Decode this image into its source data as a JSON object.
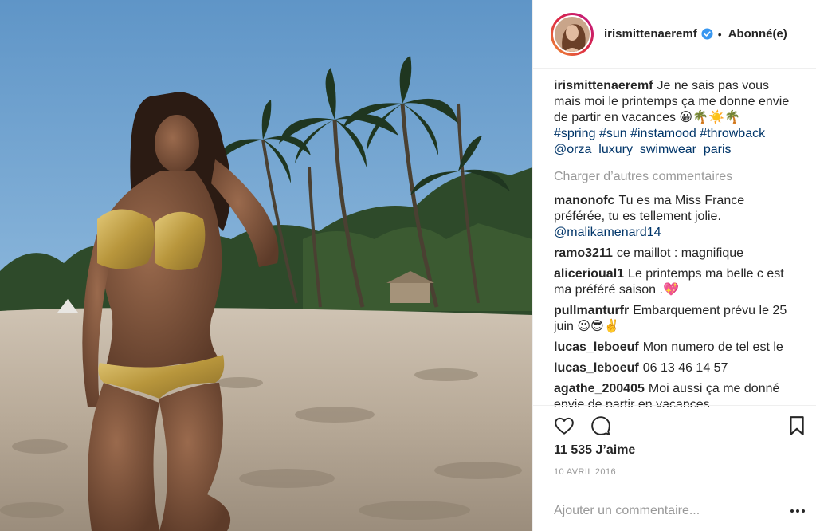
{
  "header": {
    "username": "irismittenaeremf",
    "separator": "•",
    "follow_label": "Abonné(e)"
  },
  "caption": {
    "username": "irismittenaeremf",
    "text": "Je ne sais pas vous mais moi le printemps ça me donne envie de partir en vacances 😀🌴☀️🌴",
    "hashtags": [
      "#spring",
      "#sun",
      "#instamood",
      "#throwback"
    ],
    "mention": "@orza_luxury_swimwear_paris"
  },
  "load_more_label": "Charger d’autres commentaires",
  "comments": [
    {
      "user": "manonofc",
      "text": "Tu es ma Miss France préférée, tu es tellement jolie.",
      "mention": "@malikamenard14"
    },
    {
      "user": "ramo3211",
      "text": "ce maillot : magnifique"
    },
    {
      "user": "alicerioual1",
      "text": "Le printemps ma belle c est ma préféré saison .💖"
    },
    {
      "user": "pullmanturfr",
      "text": "Embarquement prévu le 25 juin 😉😎✌️"
    },
    {
      "user": "lucas_leboeuf",
      "text": "Mon numero de tel est le"
    },
    {
      "user": "lucas_leboeuf",
      "text": "06 13 46 14 57"
    },
    {
      "user": "agathe_200405",
      "text": "Moi aussi ça me donné envie de partir en vacances"
    }
  ],
  "likes": "11 535 J’aime",
  "date": "10 AVRIL 2016",
  "comment_placeholder": "Ajouter un commentaire..."
}
